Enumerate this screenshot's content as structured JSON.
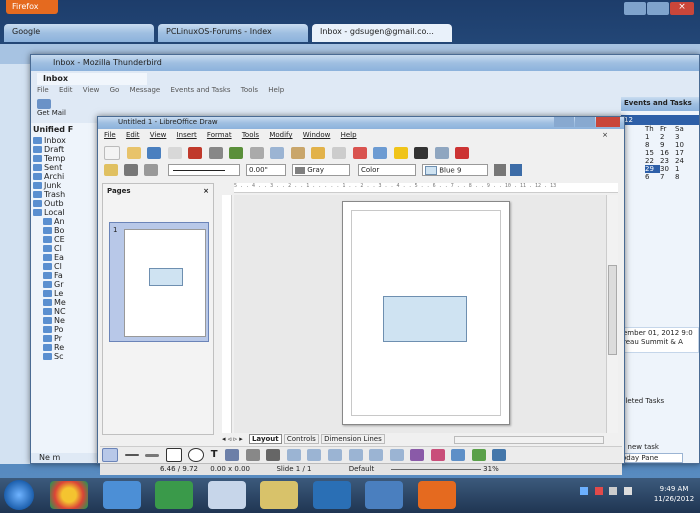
{
  "chrome": {
    "app_button": "Firefox",
    "tabs": [
      {
        "label": "Google"
      },
      {
        "label": "PCLinuxOS-Forums - Index"
      },
      {
        "label": "Inbox - gdsugen@gmail.co..."
      }
    ]
  },
  "thunderbird": {
    "title": "Inbox - Mozilla Thunderbird",
    "inner_tab": "Inbox",
    "menu": [
      "File",
      "Edit",
      "View",
      "Go",
      "Message",
      "Events and Tasks",
      "Tools",
      "Help"
    ],
    "get_mail": "Get Mail",
    "sidebar_header": "Unified F",
    "folders": [
      "Inbox",
      "Draft",
      "Temp",
      "Sent",
      "Archi",
      "Junk",
      "Trash",
      "Outb",
      "Local"
    ],
    "sub_folders": [
      "An",
      "Bo",
      "CE",
      "Cl",
      "Ea",
      "Cl",
      "Fa",
      "Gr",
      "Le",
      "Me",
      "NC",
      "Ne",
      "Po",
      "Pr",
      "Re",
      "Sc"
    ],
    "events_title": "Events and Tasks",
    "cal_month": "12",
    "cal_days": [
      "Th",
      "Fr",
      "Sa"
    ],
    "cal_rows": [
      [
        "1",
        "2",
        "3"
      ],
      [
        "8",
        "9",
        "10"
      ],
      [
        "15",
        "16",
        "17"
      ],
      [
        "22",
        "23",
        "24"
      ],
      [
        "29",
        "30",
        "1"
      ],
      [
        "6",
        "7",
        "8"
      ]
    ],
    "event_text": "ember 01, 2012 9:0 reau Summit & A",
    "tasks_label": "pleted Tasks",
    "new_task": "a new task",
    "today_pane": "oday Pane",
    "status_left": "Ne m"
  },
  "draw": {
    "title": "Untitled 1 - LibreOffice Draw",
    "menu": [
      "File",
      "Edit",
      "View",
      "Insert",
      "Format",
      "Tools",
      "Modify",
      "Window",
      "Help"
    ],
    "line_width": "0.00\"",
    "area_color_name": "Gray",
    "area_style": "Color",
    "fill_color": "Blue 9",
    "pages_title": "Pages",
    "page_number": "1",
    "ruler_labels": "5 . . 4 . . 3 . . 2 . . 1 . . . . . 1 . . 2 . . 3 . . 4 . . 5 . . 6 . . 7 . . 8 . . 9 . . 10 . 11 . 12 . 13",
    "layer_tabs": [
      "Layout",
      "Controls",
      "Dimension Lines"
    ],
    "status": {
      "position": "6.46 / 9.72",
      "size": "0.00 x 0.00",
      "slide": "Slide 1 / 1",
      "master": "Default",
      "zoom": "31%"
    }
  },
  "taskbar": {
    "time": "9:49 AM",
    "date": "11/26/2012"
  },
  "colors": {
    "rect_fill": "#cfe3f2",
    "rect_border": "#6e8fb0"
  }
}
